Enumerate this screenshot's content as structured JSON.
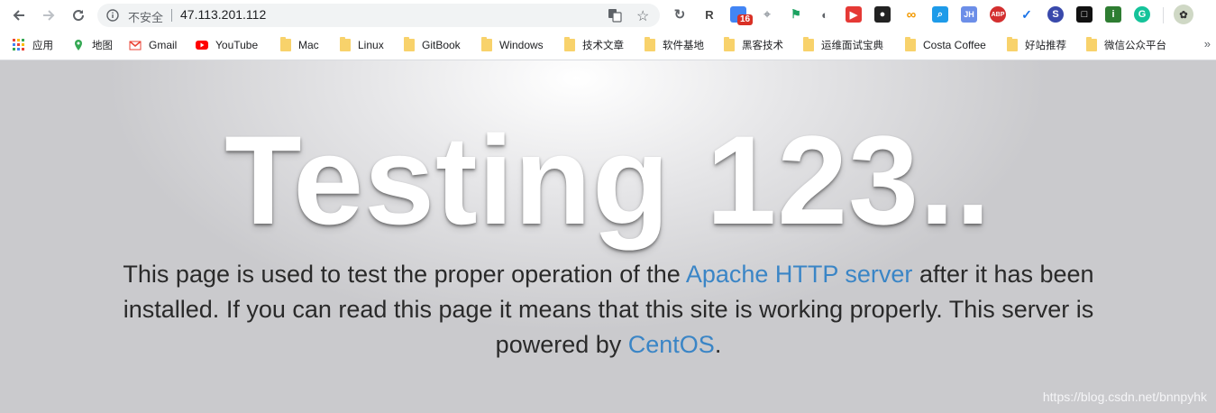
{
  "toolbar": {
    "security_label": "不安全",
    "url": "47.113.201.112",
    "extension_badge": "16",
    "ext_r_label": "R",
    "ext_jh_label": "JH",
    "ext_abp_label": "ABP",
    "ext_i_label": "i"
  },
  "bookmarks": [
    {
      "label": "应用"
    },
    {
      "label": "地图"
    },
    {
      "label": "Gmail"
    },
    {
      "label": "YouTube"
    },
    {
      "label": "Mac"
    },
    {
      "label": "Linux"
    },
    {
      "label": "GitBook"
    },
    {
      "label": "Windows"
    },
    {
      "label": "技术文章"
    },
    {
      "label": "软件基地"
    },
    {
      "label": "黑客技术"
    },
    {
      "label": "运维面试宝典"
    },
    {
      "label": "Costa Coffee"
    },
    {
      "label": "好站推荐"
    },
    {
      "label": "微信公众平台"
    }
  ],
  "bookmarks_overflow": "»",
  "page": {
    "headline": "Testing 123..",
    "lead_part1": "This page is used to test the proper operation of the ",
    "apache_link": "Apache HTTP server",
    "lead_part2": " after it has been installed. If you can read this page it means that this site is working properly. This server is powered by ",
    "centos_link": "CentOS",
    "lead_part3": ".",
    "watermark": "https://blog.csdn.net/bnnpyhk"
  },
  "colors": {
    "link": "#3a85c6",
    "folder": "#f8d26b",
    "badge": "#d93025"
  }
}
